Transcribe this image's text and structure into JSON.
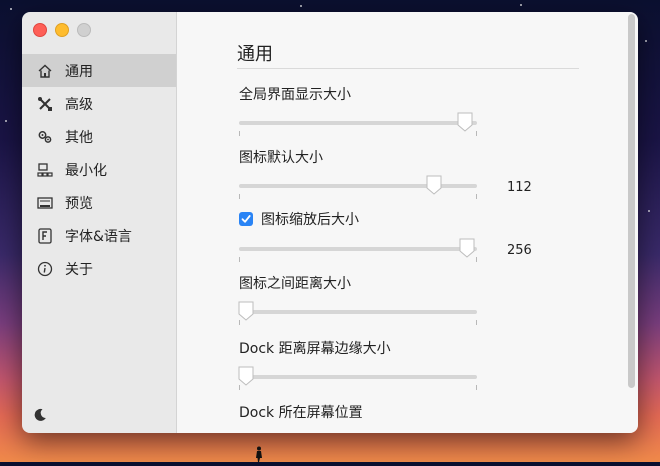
{
  "window": {
    "traffic_lights": [
      "close",
      "minimize",
      "zoom"
    ]
  },
  "sidebar": {
    "items": [
      {
        "label": "通用",
        "icon": "home-icon",
        "active": true
      },
      {
        "label": "高级",
        "icon": "tools-icon",
        "active": false
      },
      {
        "label": "其他",
        "icon": "gears-icon",
        "active": false
      },
      {
        "label": "最小化",
        "icon": "minimize-windows-icon",
        "active": false
      },
      {
        "label": "预览",
        "icon": "preview-icon",
        "active": false
      },
      {
        "label": "字体&语言",
        "icon": "font-icon",
        "active": false
      },
      {
        "label": "关于",
        "icon": "info-icon",
        "active": false
      }
    ],
    "footer_icon": "moon-icon"
  },
  "main": {
    "title": "通用",
    "settings": [
      {
        "label": "全局界面显示大小",
        "slider_fraction": 0.95,
        "value": ""
      },
      {
        "label": "图标默认大小",
        "slider_fraction": 0.82,
        "value": "112"
      },
      {
        "label": "图标缩放后大小",
        "checked": true,
        "slider_fraction": 0.96,
        "value": "256"
      },
      {
        "label": "图标之间距离大小",
        "slider_fraction": 0.03,
        "value": ""
      },
      {
        "label": "Dock 距离屏幕边缘大小",
        "slider_fraction": 0.03,
        "value": ""
      },
      {
        "label": "Dock 所在屏幕位置"
      }
    ]
  },
  "colors": {
    "accent": "#2a84f5",
    "sidebar_bg": "#e9e9e9",
    "sidebar_active": "#d0d0d0",
    "content_bg": "#f7f7f7",
    "close": "#fe5f57",
    "minimize": "#febc2e"
  }
}
